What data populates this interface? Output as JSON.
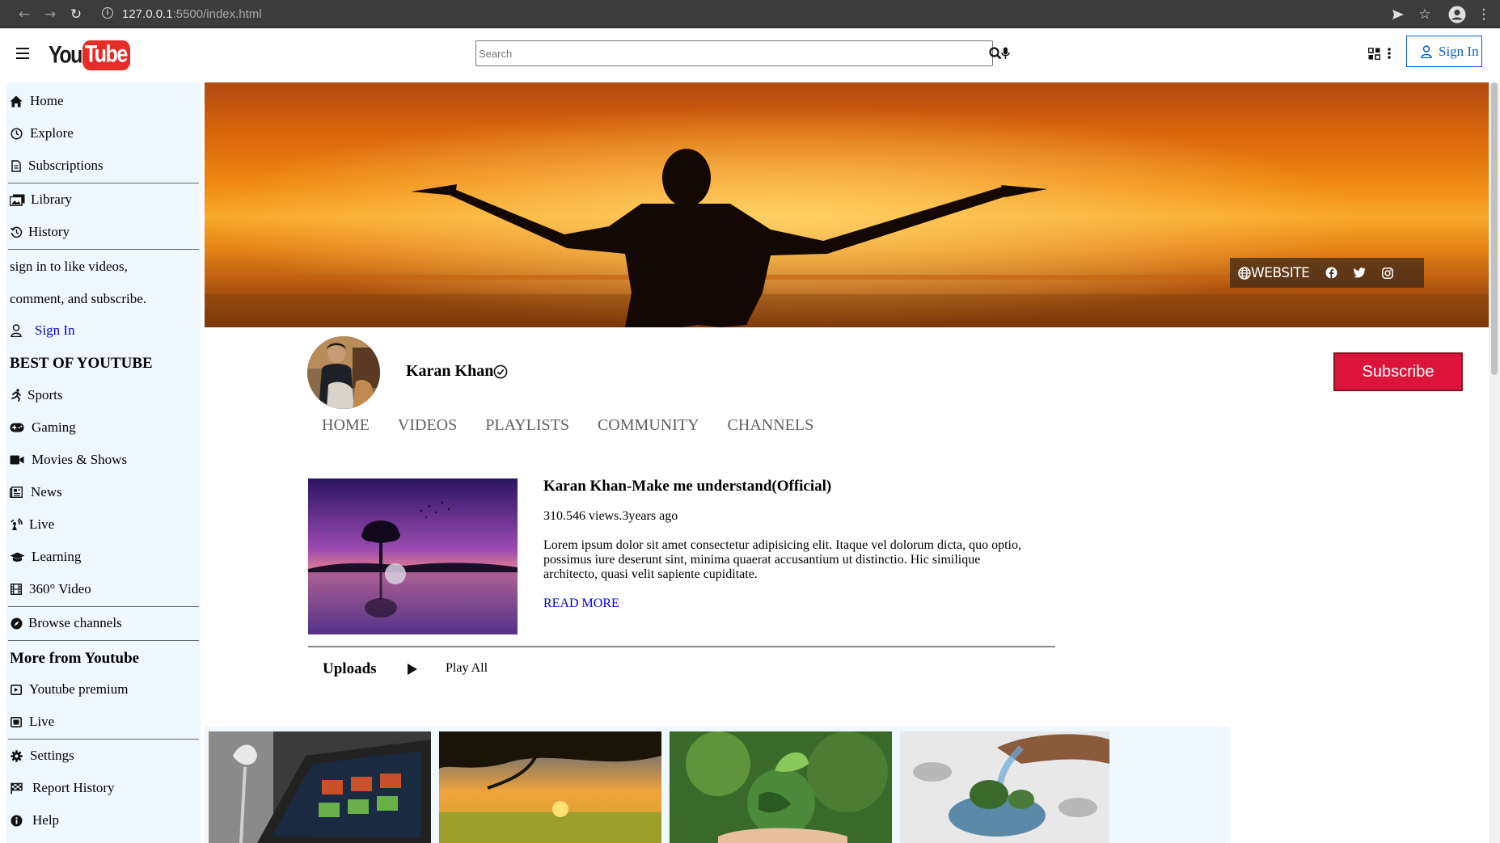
{
  "browser": {
    "url_host": "127.0.0.1",
    "url_path": ":5500/index.html"
  },
  "header": {
    "logo_you": "You",
    "logo_tube": "Tube",
    "search_placeholder": "Search",
    "signin_label": "Sign In"
  },
  "sidebar": {
    "main": [
      {
        "label": "Home",
        "icon": "home-icon"
      },
      {
        "label": "Explore",
        "icon": "compass-icon"
      },
      {
        "label": "Subscriptions",
        "icon": "subscriptions-icon"
      }
    ],
    "library": [
      {
        "label": "Library",
        "icon": "library-icon"
      },
      {
        "label": "History",
        "icon": "history-icon"
      }
    ],
    "signin_text_1": "sign in to like videos,",
    "signin_text_2": "comment, and subscribe.",
    "signin_label": "Sign In",
    "best_heading": "BEST OF YOUTUBE",
    "best": [
      {
        "label": "Sports",
        "icon": "running-icon"
      },
      {
        "label": "Gaming",
        "icon": "gamepad-icon"
      },
      {
        "label": "Movies & Shows",
        "icon": "video-camera-icon"
      },
      {
        "label": "News",
        "icon": "newspaper-icon"
      },
      {
        "label": "Live",
        "icon": "broadcast-icon"
      },
      {
        "label": "Learning",
        "icon": "graduation-cap-icon"
      },
      {
        "label": "360° Video",
        "icon": "film-icon"
      }
    ],
    "browse": {
      "label": "Browse channels",
      "icon": "compass-filled-icon"
    },
    "more_heading": "More from Youtube",
    "more": [
      {
        "label": "Youtube premium",
        "icon": "youtube-box-icon"
      },
      {
        "label": "Live",
        "icon": "live-box-icon"
      }
    ],
    "bottom": [
      {
        "label": "Settings",
        "icon": "gear-icon"
      },
      {
        "label": "Report History",
        "icon": "flag-icon"
      },
      {
        "label": "Help",
        "icon": "info-icon"
      }
    ]
  },
  "banner": {
    "website_label": "WEBSITE"
  },
  "channel": {
    "name": "Karan Khan",
    "subscribe_label": "Subscribe",
    "tabs": [
      "HOME",
      "VIDEOS",
      "PLAYLISTS",
      "COMMUNITY",
      "CHANNELS"
    ]
  },
  "featured": {
    "title": "Karan Khan-Make me understand(Official)",
    "meta": "310.546 views.3years ago",
    "description": "Lorem ipsum dolor sit amet consectetur adipisicing elit. Itaque vel dolorum dicta, quo optio, possimus iure deserunt sint, minima quaerat accusantium ut distinctio. Hic similique architecto, quasi velit sapiente cupiditate.",
    "read_more": "READ MORE"
  },
  "uploads": {
    "heading": "Uploads",
    "play_all": "Play All"
  },
  "colors": {
    "subscribe_bg": "#dc143c",
    "sidebar_bg": "#f0f8ff",
    "signin_blue": "#065fd4"
  }
}
